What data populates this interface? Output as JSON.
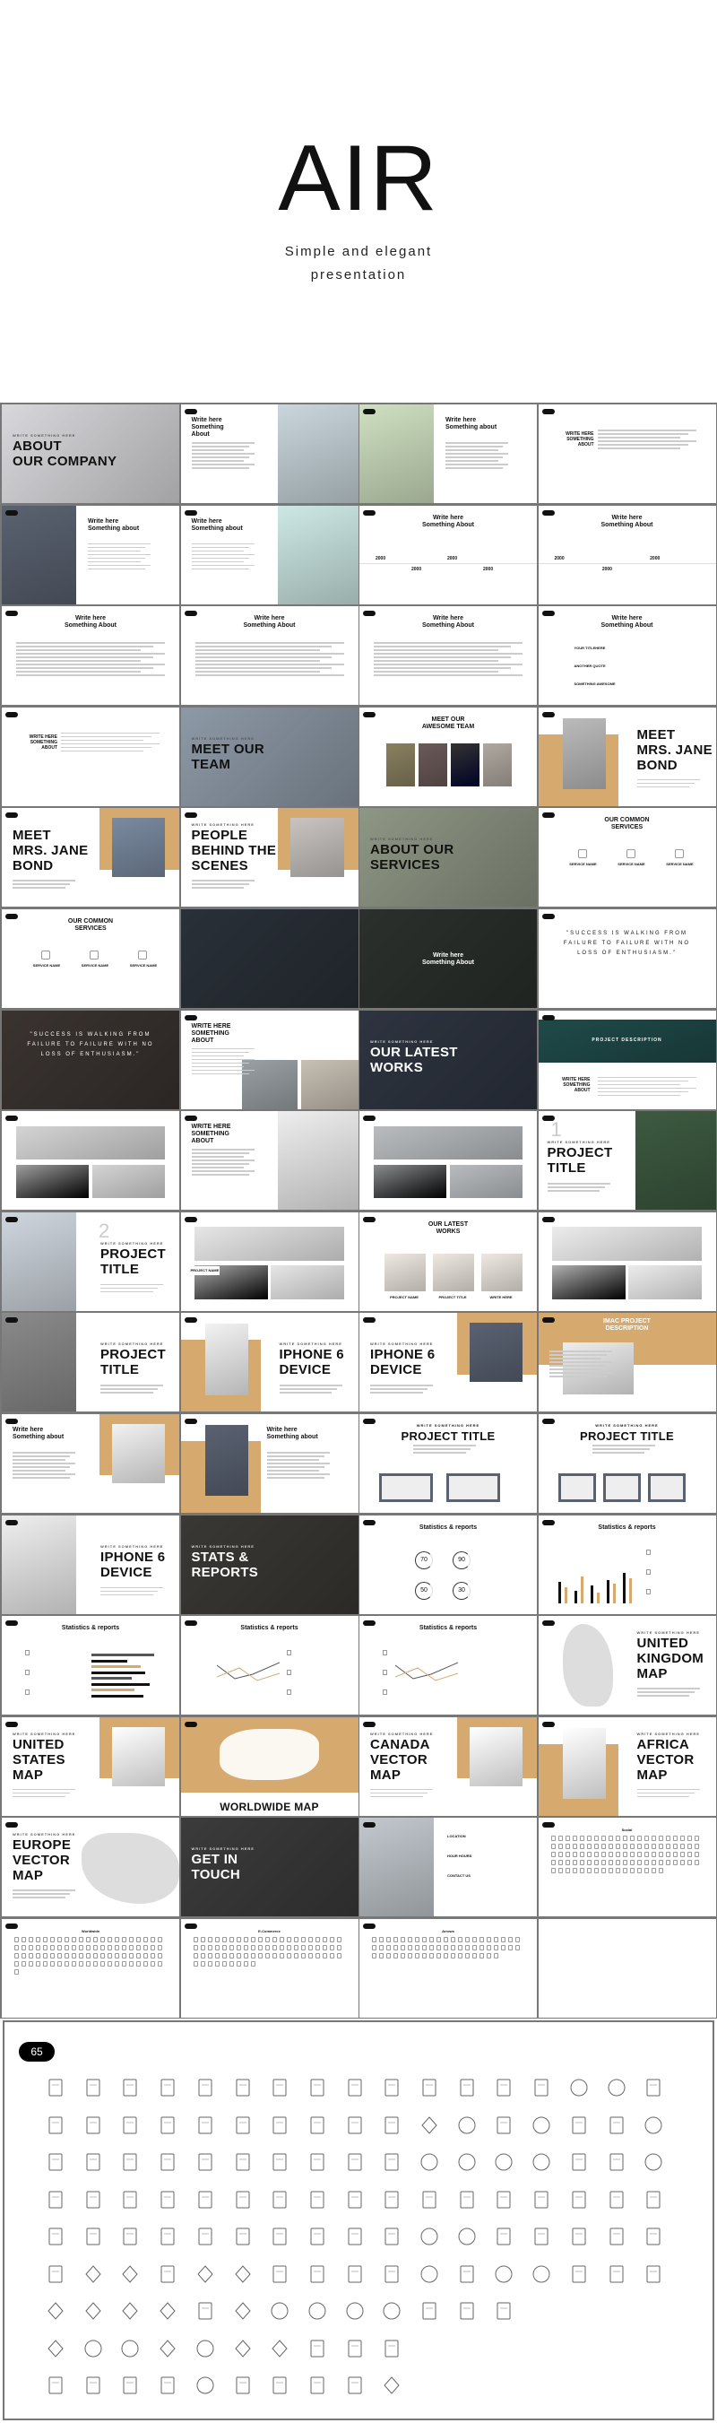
{
  "hero": {
    "title": "AIR",
    "subtitle_line1": "Simple and elegant",
    "subtitle_line2": "presentation"
  },
  "colors": {
    "accent_gold": "#d6a96f",
    "dark": "#111111",
    "grid_border": "#777777"
  },
  "slides": [
    {
      "layout": "hero",
      "tone": "#d8d8dc",
      "kicker": "WRITE SOMETHING HERE",
      "title": "ABOUT\nOUR COMPANY"
    },
    {
      "layout": "photo-right",
      "tone": "#c9d6dc",
      "heading": "Write here\nSomething\nAbout"
    },
    {
      "layout": "photo-left",
      "tone": "#cfe0c0",
      "heading": "Write here\nSomething about"
    },
    {
      "layout": "center-side",
      "heading": "WRITE HERE\nSOMETHING\nABOUT"
    },
    {
      "layout": "photo-left",
      "tone": "#5a6270",
      "heading": "Write here\nSomething about"
    },
    {
      "layout": "photo-right",
      "tone": "#cde8e4",
      "heading": "Write here\nSomething about"
    },
    {
      "layout": "center",
      "heading": "Write here\nSomething About",
      "stats": [
        "2000",
        "2000",
        "2000",
        "2000"
      ]
    },
    {
      "layout": "center",
      "heading": "Write here\nSomething About",
      "stats": [
        "2000",
        "2000",
        "2000"
      ]
    },
    {
      "layout": "center",
      "heading": "Write here\nSomething About"
    },
    {
      "layout": "center",
      "heading": "Write here\nSomething About"
    },
    {
      "layout": "center",
      "heading": "Write here\nSomething About"
    },
    {
      "layout": "center",
      "heading": "Write here\nSomething About",
      "items": [
        "YOUR TITLEHERE",
        "ANOTHER QUOTE",
        "SOMETHING AWESOME"
      ]
    },
    {
      "layout": "center-side",
      "heading": "WRITE HERE\nSOMETHING\nABOUT"
    },
    {
      "layout": "hero",
      "tone": "#8d99a6",
      "kicker": "WRITE SOMETHING HERE",
      "title": "MEET OUR\nTEAM"
    },
    {
      "layout": "center",
      "heading": "MEET OUR\nAWESOME TEAM",
      "team": 4
    },
    {
      "layout": "gold-left",
      "tone": "#bbbbbb",
      "title": "MEET\nMRS. JANE\nBOND"
    },
    {
      "layout": "gold-right",
      "tone": "#7a8aa0",
      "title": "MEET\nMRS. JANE\nBOND"
    },
    {
      "layout": "gold-right",
      "tone": "#c9c4c0",
      "kicker": "WRITE SOMETHING HERE",
      "title": "PEOPLE\nBEHIND THE\nSCENES"
    },
    {
      "layout": "hero",
      "tone": "#8e9684",
      "kicker": "WRITE SOMETHING HERE",
      "title": "ABOUT OUR\nSERVICES"
    },
    {
      "layout": "center",
      "heading": "OUR COMMON\nSERVICES",
      "items": [
        "SERVICE NAME",
        "SERVICE NAME",
        "SERVICE NAME"
      ]
    },
    {
      "layout": "center",
      "heading": "OUR COMMON\nSERVICES",
      "items": [
        "SERVICE NAME",
        "SERVICE NAME",
        "SERVICE NAME"
      ]
    },
    {
      "layout": "dark",
      "tone": "#2a3038",
      "title": ""
    },
    {
      "layout": "dark",
      "tone": "#2b302c",
      "heading": "Write here\nSomething About"
    },
    {
      "layout": "quote",
      "quote": "\"SUCCESS IS WALKING FROM FAILURE TO FAILURE WITH NO LOSS OF ENTHUSIASM.\""
    },
    {
      "layout": "quote-dark",
      "tone": "#3a3330",
      "quote": "\"SUCCESS IS WALKING FROM FAILURE TO FAILURE WITH NO LOSS OF ENTHUSIASM.\""
    },
    {
      "layout": "photo-bottom",
      "tone": "#9aa0a4",
      "heading": "WRITE HERE\nSOMETHING\nABOUT"
    },
    {
      "layout": "hero",
      "tone": "#2e3440",
      "kicker": "WRITE SOMETHING HERE",
      "title": "OUR LATEST\nWORKS",
      "light": true
    },
    {
      "layout": "photo-top",
      "tone": "#1f4a48",
      "band": "PROJECT DESCRIPTION",
      "heading": "WRITE HERE\nSOMETHING\nABOUT"
    },
    {
      "layout": "grid",
      "tone": "#d4d4d4"
    },
    {
      "layout": "photo-right",
      "tone": "#eeeeee",
      "heading": "WRITE HERE\nSOMETHING\nABOUT"
    },
    {
      "layout": "grid",
      "tone": "#b9bcbf"
    },
    {
      "layout": "photo-right",
      "tone": "#3d5a40",
      "num": "1",
      "kicker": "WRITE SOMETHING HERE",
      "title": "PROJECT\nTITLE"
    },
    {
      "layout": "photo-left",
      "tone": "#cfd6de",
      "num": "2",
      "kicker": "WRITE SOMETHING HERE",
      "title": "PROJECT\nTITLE"
    },
    {
      "layout": "grid",
      "tone": "#e6e6e6",
      "heading": "PROJECT NAME"
    },
    {
      "layout": "center",
      "heading": "OUR LATEST\nWORKS",
      "items": [
        "PROJECT NAME",
        "PROJECT TITLE",
        "WRITE HERE"
      ]
    },
    {
      "layout": "grid",
      "tone": "#ececec"
    },
    {
      "layout": "photo-left",
      "tone": "#8a8a8a",
      "kicker": "WRITE SOMETHING HERE",
      "title": "PROJECT\nTITLE"
    },
    {
      "layout": "gold-left",
      "tone": "#f2f2f2",
      "kicker": "WRITE SOMETHING HERE",
      "title": "IPHONE 6\nDEVICE"
    },
    {
      "layout": "gold-right",
      "tone": "#5a6272",
      "kicker": "WRITE SOMETHING HERE",
      "title": "IPHONE 6\nDEVICE"
    },
    {
      "layout": "gold-top",
      "tone": "#eeeeee",
      "heading": "IMAC PROJECT\nDESCRIPTION"
    },
    {
      "layout": "gold-right",
      "tone": "#f2f2f2",
      "heading": "Write here\nSomething about"
    },
    {
      "layout": "gold-left",
      "tone": "#5a6272",
      "heading": "Write here\nSomething about"
    },
    {
      "layout": "center",
      "kicker": "WRITE SOMETHING HERE",
      "title": "PROJECT TITLE",
      "devices": 2
    },
    {
      "layout": "center",
      "kicker": "WRITE SOMETHING HERE",
      "title": "PROJECT TITLE",
      "devices": 3
    },
    {
      "layout": "photo-left",
      "tone": "#eeeeee",
      "kicker": "WRITE SOMETHING HERE",
      "title": "IPHONE 6\nDEVICE"
    },
    {
      "layout": "hero",
      "tone": "#3a3834",
      "kicker": "WRITE SOMETHING HERE",
      "title": "STATS &\nREPORTS",
      "light": true
    },
    {
      "layout": "center",
      "heading": "Statistics & reports",
      "rings": [
        "70",
        "90",
        "50",
        "30"
      ]
    },
    {
      "layout": "center",
      "heading": "Statistics & reports",
      "chart": "bars"
    },
    {
      "layout": "center",
      "heading": "Statistics & reports",
      "chart": "hbars"
    },
    {
      "layout": "center",
      "heading": "Statistics & reports",
      "chart": "lines"
    },
    {
      "layout": "center",
      "heading": "Statistics & reports",
      "chart": "lines"
    },
    {
      "layout": "map-left",
      "tone": "#dddddd",
      "kicker": "WRITE SOMETHING HERE",
      "title": "UNITED\nKINGDOM\nMAP"
    },
    {
      "layout": "gold-right",
      "tone": "#ffffff",
      "kicker": "WRITE SOMETHING HERE",
      "title": "UNITED\nSTATES\nMAP"
    },
    {
      "layout": "gold-world",
      "title": "WORLDWIDE MAP"
    },
    {
      "layout": "gold-right",
      "tone": "#ffffff",
      "kicker": "WRITE SOMETHING HERE",
      "title": "CANADA\nVECTOR\nMAP"
    },
    {
      "layout": "gold-left",
      "tone": "#ffffff",
      "kicker": "WRITE SOMETHING HERE",
      "title": "AFRICA\nVECTOR\nMAP"
    },
    {
      "layout": "map-right",
      "tone": "#dddddd",
      "kicker": "WRITE SOMETHING HERE",
      "title": "EUROPE\nVECTOR\nMAP"
    },
    {
      "layout": "hero",
      "tone": "#3b3b3b",
      "kicker": "WRITE SOMETHING HERE",
      "title": "GET IN\nTOUCH",
      "light": true
    },
    {
      "layout": "photo-left",
      "tone": "#c2c8ce",
      "items": [
        "LOCATION",
        "HOUR HOURS",
        "CONTACT US"
      ]
    },
    {
      "layout": "icons",
      "heading": "Social",
      "count": 100
    },
    {
      "layout": "icons",
      "heading": "Worldwide",
      "count": 85
    },
    {
      "layout": "icons",
      "heading": "E-Commerce",
      "count": 72
    },
    {
      "layout": "icons",
      "heading": "Arrows",
      "count": 60
    },
    {
      "layout": "blank"
    }
  ],
  "icon_sheet": {
    "count_label": "65",
    "rows": [
      [
        "mail",
        "mail-open",
        "mail-letter",
        "mail-stack",
        "newspaper",
        "newspapers",
        "battery-vertical",
        "battery-charging",
        "battery-empty",
        "files",
        "lock",
        "unlock",
        "key",
        "link",
        "female",
        "male",
        "share"
      ],
      [
        "notebook",
        "notebook-pencil",
        "notebook-pen",
        "clipboard-pencil",
        "clipboard-pen",
        "clipboard-list",
        "clipboard-text",
        "document-pencil",
        "document-pen",
        "ruler-pencil",
        "map-pin",
        "compass",
        "map",
        "globe-stand",
        "map-location",
        "signpost",
        "globe"
      ],
      [
        "set-square",
        "book-open",
        "book",
        "book-text",
        "book-bookmark",
        "agenda",
        "agenda-pencil",
        "agenda-pen",
        "inbox-tray",
        "inbox-full",
        "clock",
        "reload-clock",
        "history",
        "stopwatch",
        "hourglass",
        "watch",
        "alarm-clock"
      ],
      [
        "home",
        "windows",
        "browser",
        "browser-layout",
        "browser-text",
        "clipboard",
        "clipboard-lines",
        "document",
        "document-text",
        "documents",
        "ipod",
        "mobile",
        "smartphone",
        "desktop",
        "laptop",
        "printer",
        "keyboard"
      ],
      [
        "folder",
        "folders",
        "chat",
        "chats",
        "comment-text",
        "search",
        "zoom-out",
        "zoom-in",
        "upload-box",
        "download-box",
        "mouse",
        "mouse-scroll",
        "floppy",
        "database",
        "drive",
        "drive-download",
        "drive-upload"
      ],
      [
        "calendar",
        "balloon-pin",
        "push-pin",
        "bookmark",
        "flag",
        "flag-waving",
        "battery-low",
        "battery-half",
        "battery-full",
        "battery-charge",
        "crosshair",
        "sliders",
        "target",
        "speedometer",
        "eye",
        "eye-off",
        "recycle-bin"
      ],
      [
        "heart",
        "diamond",
        "spade",
        "club",
        "cards",
        "cards-heart",
        "info",
        "help",
        "forbidden",
        "exclamation",
        "headset",
        "usb",
        "gamepad"
      ],
      [
        "anchor",
        "lifebuoy",
        "helm",
        "lightning",
        "cloud",
        "star",
        "broken-heart",
        "lightbulb",
        "trophy",
        "briefcase"
      ],
      [
        "video-camera",
        "camera",
        "image",
        "images",
        "gear",
        "tools",
        "hammer",
        "calculator",
        "rss",
        "paper-plane"
      ]
    ]
  }
}
